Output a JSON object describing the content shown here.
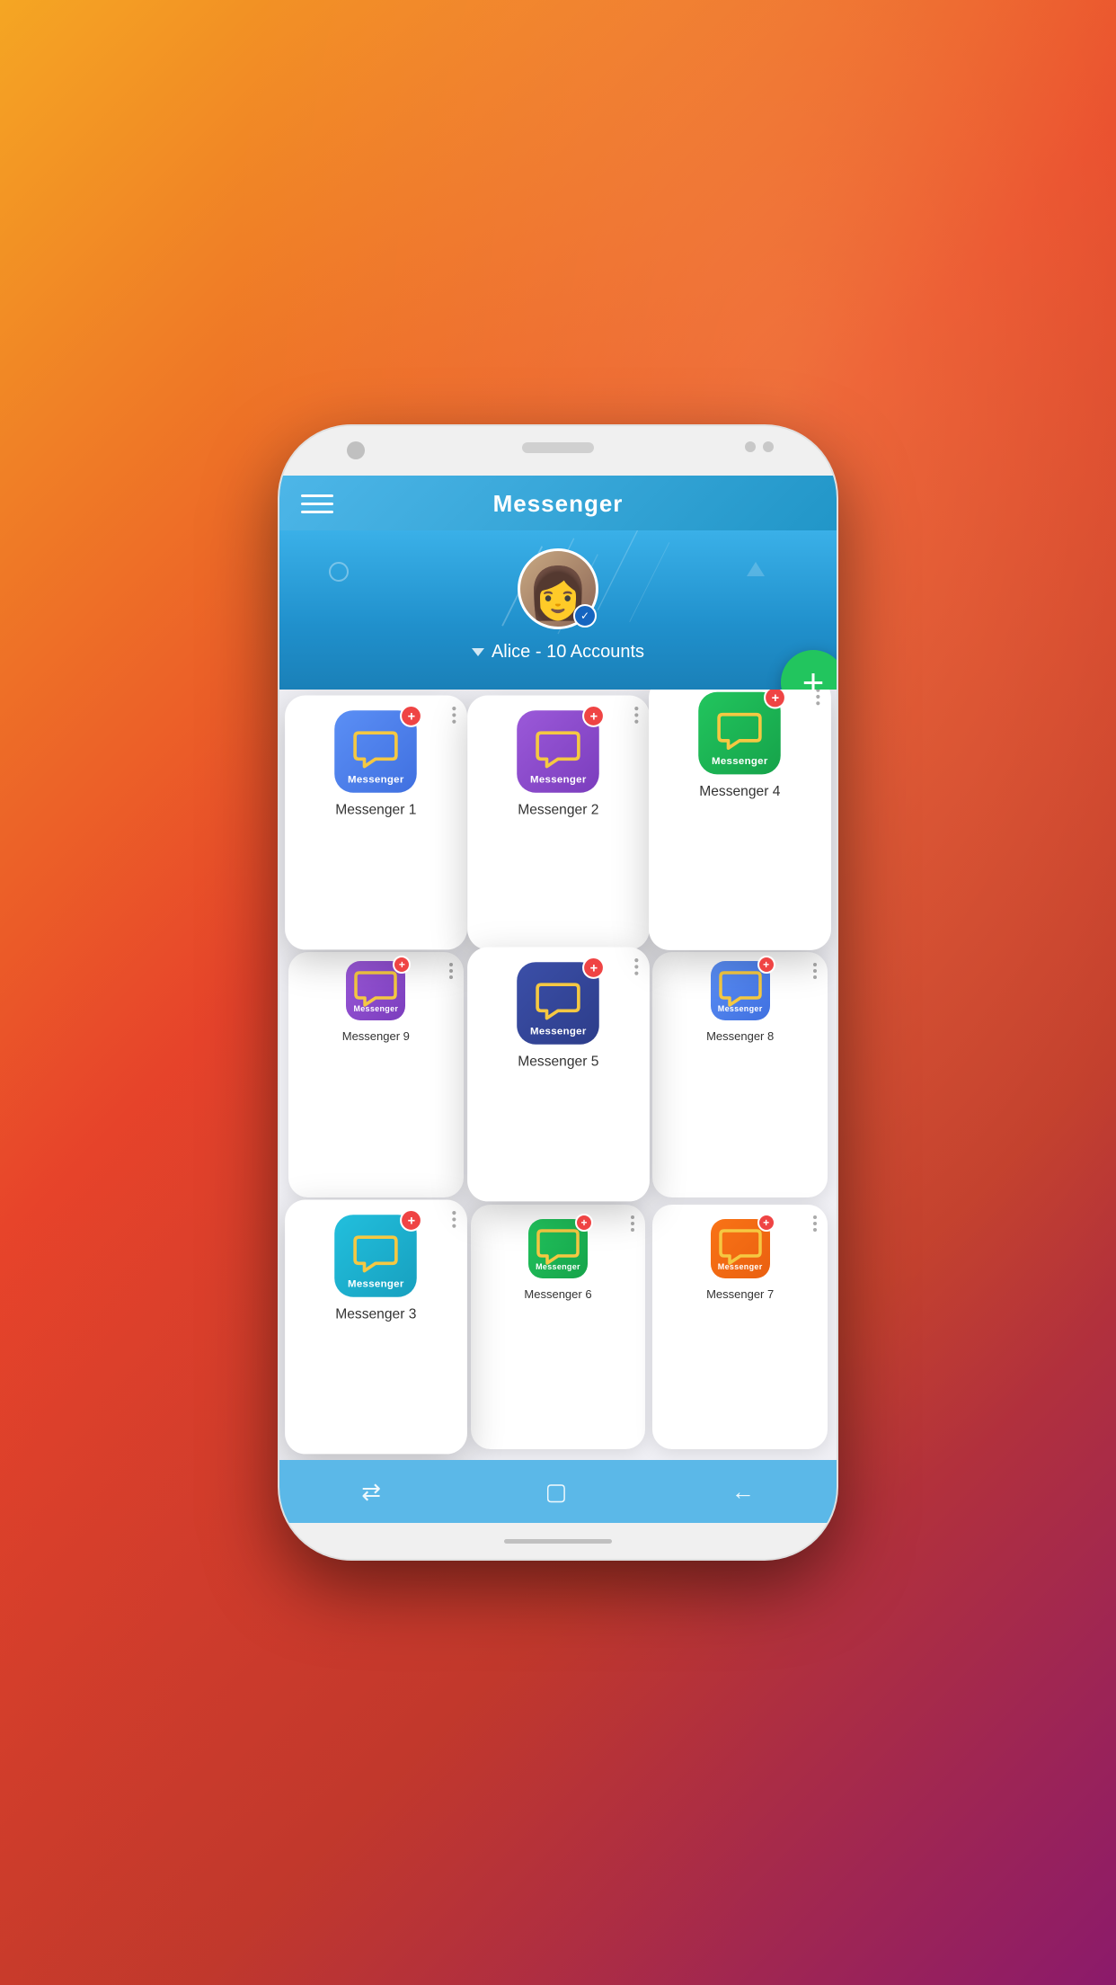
{
  "app": {
    "title": "Messenger"
  },
  "profile": {
    "name": "Alice",
    "accounts_label": "Alice - 10 Accounts",
    "avatar_emoji": "👩"
  },
  "fab": {
    "label": "+"
  },
  "messengers": [
    {
      "id": 1,
      "name": "Messenger 1",
      "color": "icon-blue",
      "elevated": true
    },
    {
      "id": 2,
      "name": "Messenger 2",
      "color": "icon-purple",
      "elevated": true
    },
    {
      "id": 3,
      "name": "Messenger 3",
      "color": "icon-cyan",
      "elevated": false
    },
    {
      "id": 4,
      "name": "Messenger 4",
      "color": "icon-green",
      "elevated": true
    },
    {
      "id": 5,
      "name": "Messenger 5",
      "color": "icon-navy",
      "elevated": true
    },
    {
      "id": 6,
      "name": "Messenger 6",
      "color": "icon-green",
      "elevated": false
    },
    {
      "id": 7,
      "name": "Messenger 7",
      "color": "icon-orange",
      "elevated": false
    },
    {
      "id": 8,
      "name": "Messenger 8",
      "color": "icon-blue",
      "elevated": false
    },
    {
      "id": 9,
      "name": "Messenger 9",
      "color": "icon-purple",
      "elevated": false
    }
  ],
  "icons": {
    "hamburger": "≡",
    "add": "+",
    "edit": "✎",
    "menu_dots": "⋮",
    "nav_switch": "⇄",
    "nav_square": "▢",
    "nav_back": "←"
  }
}
